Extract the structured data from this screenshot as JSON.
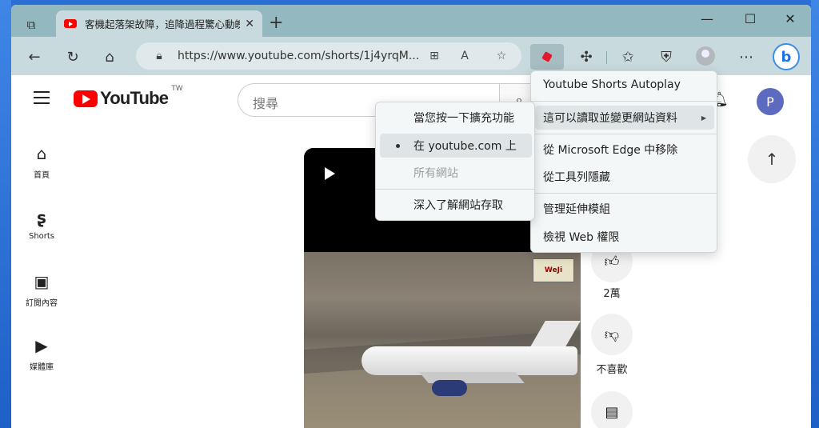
{
  "browser": {
    "tab_title": "客機起落架故障，追降過程驚心動魄",
    "url": "https://www.youtube.com/shorts/1j4yrqM...",
    "window_controls": {
      "minimize": "—",
      "maximize": "☐",
      "close": "✕"
    }
  },
  "youtube": {
    "logo_text": "YouTube",
    "region": "TW",
    "search_placeholder": "搜尋",
    "profile_initial": "P",
    "nav": [
      {
        "label": "首頁",
        "icon": "home-icon"
      },
      {
        "label": "Shorts",
        "icon": "shorts-icon"
      },
      {
        "label": "訂閱內容",
        "icon": "subscriptions-icon"
      },
      {
        "label": "媒體庫",
        "icon": "library-icon"
      }
    ],
    "actions": {
      "like_count": "2萬",
      "dislike_label": "不喜歡"
    },
    "video_badge": "WeJi"
  },
  "extension_menu": {
    "title": "Youtube Shorts Autoplay",
    "items": [
      {
        "label": "這可以讀取並變更網站資料",
        "has_submenu": true
      },
      {
        "label": "從 Microsoft Edge 中移除"
      },
      {
        "label": "從工具列隱藏"
      },
      {
        "label": "管理延伸模組"
      },
      {
        "label": "檢視 Web 權限"
      }
    ]
  },
  "site_access_submenu": {
    "items": [
      {
        "label": "當您按一下擴充功能",
        "selected": false,
        "disabled": false
      },
      {
        "label": "在 youtube.com 上",
        "selected": true,
        "disabled": false
      },
      {
        "label": "所有網站",
        "selected": false,
        "disabled": true
      },
      {
        "label": "深入了解網站存取",
        "selected": false,
        "disabled": false
      }
    ]
  }
}
